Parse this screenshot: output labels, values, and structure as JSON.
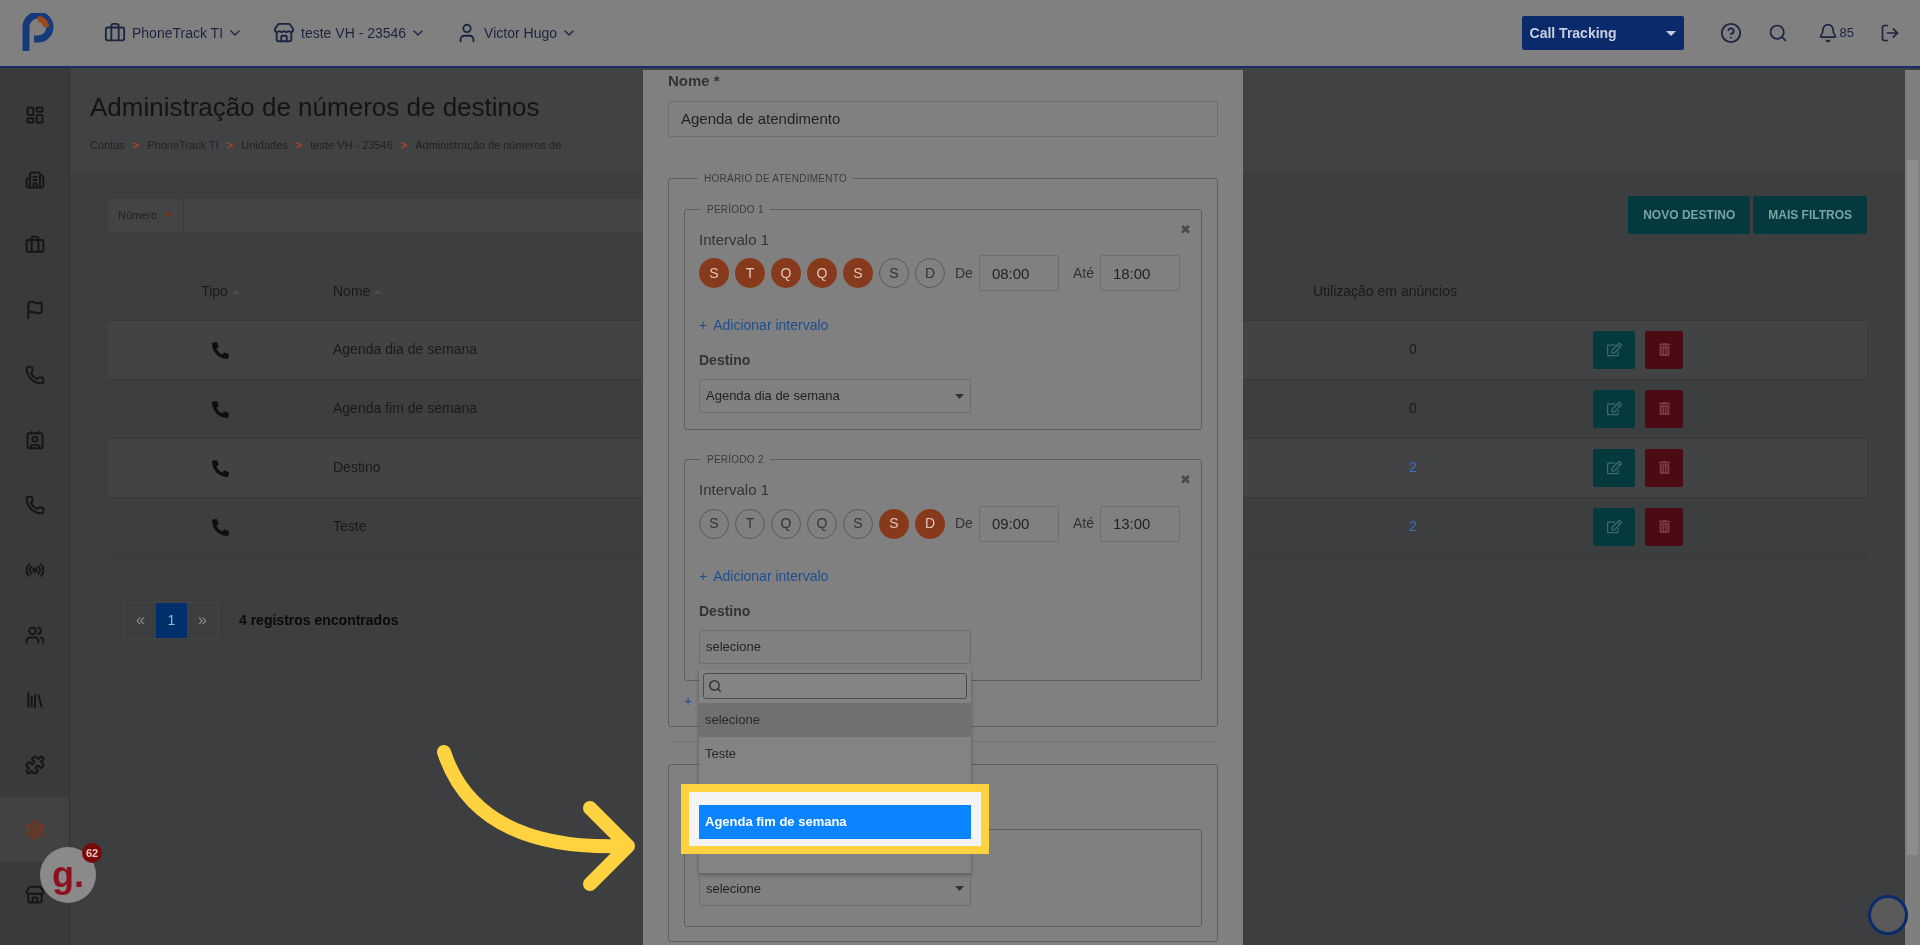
{
  "topbar": {
    "account": "PhoneTrack TI",
    "unit": "teste VH - 23546",
    "user": "Victor Hugo",
    "product": "Call Tracking",
    "notifications": "85"
  },
  "sidebar": {
    "items": [
      {
        "selected": false
      },
      {
        "selected": false
      },
      {
        "selected": false
      },
      {
        "selected": false
      },
      {
        "selected": false
      },
      {
        "selected": false
      },
      {
        "selected": false
      },
      {
        "selected": false
      },
      {
        "selected": false
      },
      {
        "selected": false
      },
      {
        "selected": false
      },
      {
        "selected": true
      },
      {
        "selected": false
      }
    ]
  },
  "page": {
    "title": "Administração de números de destinos",
    "breadcrumb": [
      "Contas",
      "PhoneTrack TI",
      "Unidades",
      "teste VH - 23546",
      "Administração de números de"
    ],
    "separator": ">"
  },
  "filter": {
    "label": "Número"
  },
  "buttons": [
    "NOVO DESTINO",
    "MAIS FILTROS"
  ],
  "table": {
    "columns": [
      "Tipo",
      "Nome",
      "Utilização em anúncios"
    ],
    "rows": [
      {
        "name": "Agenda dia de semana",
        "usage": "0",
        "usage_link": false
      },
      {
        "name": "Agenda fim de semana",
        "usage": "0",
        "usage_link": false
      },
      {
        "name": "Destino",
        "usage": "2",
        "usage_link": true
      },
      {
        "name": "Teste",
        "usage": "2",
        "usage_link": true
      }
    ]
  },
  "pagination": {
    "prev": "«",
    "pages": [
      {
        "label": "1",
        "selected": true
      }
    ],
    "next": "»",
    "summary": "4 registros encontrados"
  },
  "modal": {
    "name_label": "Nome *",
    "name_value": "Agenda de atendimento",
    "schedule_legend": "HORÁRIO DE ATENDIMENTO",
    "periods": [
      {
        "legend": "PERÍODO 1",
        "close": "✖",
        "interval": "Intervalo 1",
        "days": [
          {
            "label": "S",
            "selected": true
          },
          {
            "label": "T",
            "selected": true
          },
          {
            "label": "Q",
            "selected": true
          },
          {
            "label": "Q",
            "selected": true
          },
          {
            "label": "S",
            "selected": true
          },
          {
            "label": "S",
            "selected": false
          },
          {
            "label": "D",
            "selected": false
          }
        ],
        "from_label": "De",
        "from": "08:00",
        "to_label": "Até",
        "to": "18:00",
        "add_interval": "Adicionar intervalo",
        "destination_label": "Destino",
        "destination": "Agenda dia de semana",
        "open": false
      },
      {
        "legend": "PERÍODO 2",
        "close": "✖",
        "interval": "Intervalo 1",
        "days": [
          {
            "label": "S",
            "selected": false
          },
          {
            "label": "T",
            "selected": false
          },
          {
            "label": "Q",
            "selected": false
          },
          {
            "label": "Q",
            "selected": false
          },
          {
            "label": "S",
            "selected": false
          },
          {
            "label": "S",
            "selected": true
          },
          {
            "label": "D",
            "selected": true
          }
        ],
        "from_label": "De",
        "from": "09:00",
        "to_label": "Até",
        "to": "13:00",
        "add_interval": "Adicionar intervalo",
        "destination_label": "Destino",
        "destination": "selecione",
        "open": true
      }
    ],
    "add_period": "+",
    "add_icon": "+",
    "second_select": "selecione",
    "dropdown": {
      "options": [
        {
          "label": "selecione",
          "selected": true,
          "highlighted": false
        },
        {
          "label": "Teste",
          "selected": false,
          "highlighted": false
        },
        {
          "label": "Agenda fim de semana",
          "selected": false,
          "highlighted": true
        }
      ]
    }
  },
  "chat_widget": {
    "logo": "g.",
    "badge": "62"
  }
}
